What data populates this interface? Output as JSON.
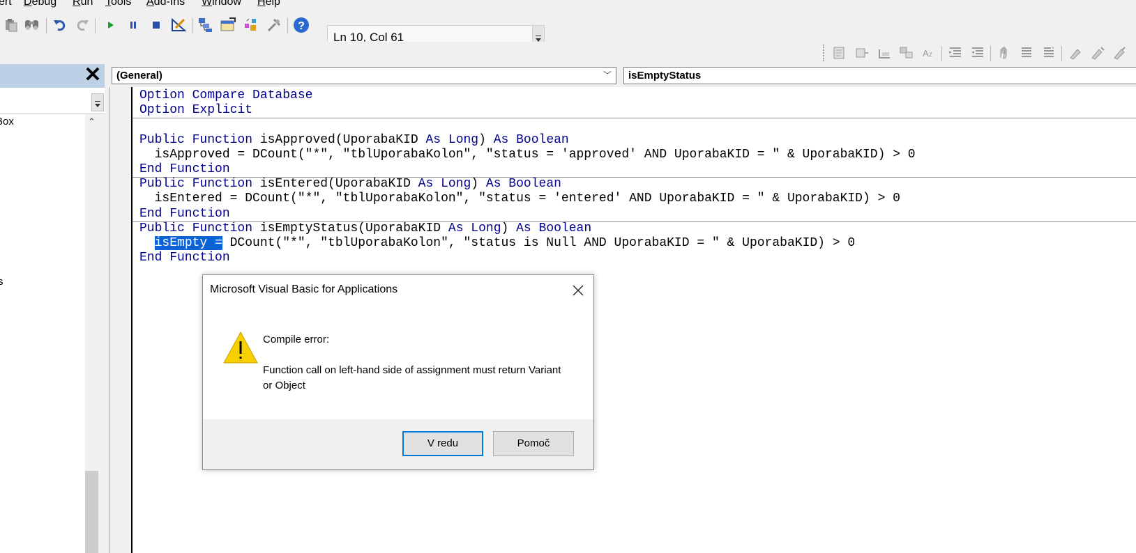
{
  "menubar": {
    "items": [
      {
        "pre": "",
        "ul": "",
        "post": "ert"
      },
      {
        "pre": "",
        "ul": "D",
        "post": "ebug"
      },
      {
        "pre": "",
        "ul": "R",
        "post": "un"
      },
      {
        "pre": "",
        "ul": "T",
        "post": "ools"
      },
      {
        "pre": "",
        "ul": "A",
        "post": "dd-Ins"
      },
      {
        "pre": "",
        "ul": "W",
        "post": "indow"
      },
      {
        "pre": "",
        "ul": "H",
        "post": "elp"
      }
    ]
  },
  "toolbar": {
    "status_text": "Ln 10, Col 61",
    "icons": [
      "paste-icon",
      "find-icon",
      "undo-icon",
      "redo-icon",
      "run-icon",
      "break-icon",
      "reset-icon",
      "design-mode-icon",
      "project-explorer-icon",
      "properties-window-icon",
      "object-browser-icon",
      "toolbox-icon",
      "help-icon"
    ],
    "edit_icons": [
      "list-properties-icon",
      "list-constants-icon",
      "quick-info-icon",
      "parameter-info-icon",
      "complete-word-icon",
      "indent-icon",
      "outdent-icon",
      "toggle-breakpoint-icon",
      "comment-block-icon",
      "uncomment-block-icon",
      "toggle-bookmark-icon",
      "next-bookmark-icon",
      "previous-bookmark-icon"
    ]
  },
  "left_panel": {
    "close_glyph": "✕",
    "tree_items": [
      "Box",
      "s"
    ]
  },
  "code_window": {
    "object_combo": "(General)",
    "procedure_combo": "isEmptyStatus",
    "lines": [
      {
        "parts": [
          {
            "t": "Option Compare Database",
            "k": true
          }
        ]
      },
      {
        "parts": [
          {
            "t": "Option Explicit",
            "k": true
          }
        ]
      },
      {
        "parts": []
      },
      {
        "parts": [
          {
            "t": "Public Function",
            "k": true
          },
          {
            "t": " isApproved(UporabaKID "
          },
          {
            "t": "As Long",
            "k": true
          },
          {
            "t": ") "
          },
          {
            "t": "As Boolean",
            "k": true
          }
        ]
      },
      {
        "parts": [
          {
            "t": "  isApproved = DCount(\"*\", \"tblUporabaKolon\", \"status = 'approved' AND UporabaKID = \" & UporabaKID) > 0"
          }
        ]
      },
      {
        "parts": [
          {
            "t": "End Function",
            "k": true
          }
        ]
      },
      {
        "parts": [
          {
            "t": "Public Function",
            "k": true
          },
          {
            "t": " isEntered(UporabaKID "
          },
          {
            "t": "As Long",
            "k": true
          },
          {
            "t": ") "
          },
          {
            "t": "As Boolean",
            "k": true
          }
        ]
      },
      {
        "parts": [
          {
            "t": "  isEntered = DCount(\"*\", \"tblUporabaKolon\", \"status = 'entered' AND UporabaKID = \" & UporabaKID) > 0"
          }
        ]
      },
      {
        "parts": [
          {
            "t": "End Function",
            "k": true
          }
        ]
      },
      {
        "parts": [
          {
            "t": "Public Function",
            "k": true
          },
          {
            "t": " isEmptyStatus(UporabaKID "
          },
          {
            "t": "As Long",
            "k": true
          },
          {
            "t": ") "
          },
          {
            "t": "As Boolean",
            "k": true
          }
        ]
      },
      {
        "parts": [
          {
            "t": "  "
          },
          {
            "t": "isEmpty =",
            "s": true
          },
          {
            "t": " DCount(\"*\", \"tblUporabaKolon\", \"status is Null AND UporabaKID = \" & UporabaKID) > 0"
          }
        ]
      },
      {
        "parts": [
          {
            "t": "End Function",
            "k": true
          }
        ]
      }
    ],
    "separators_after_line": [
      1,
      5,
      8
    ]
  },
  "dialog": {
    "title": "Microsoft Visual Basic for Applications",
    "heading": "Compile error:",
    "message": "Function call on left-hand side of assignment must return Variant or Object",
    "ok_label": "V redu",
    "help_label": "Pomoč",
    "icon": "warning-icon"
  },
  "colors": {
    "keyword": "#00008b",
    "selection": "#0a64d8",
    "panel_title": "#bcd0e6",
    "default_button_border": "#0078d7"
  }
}
